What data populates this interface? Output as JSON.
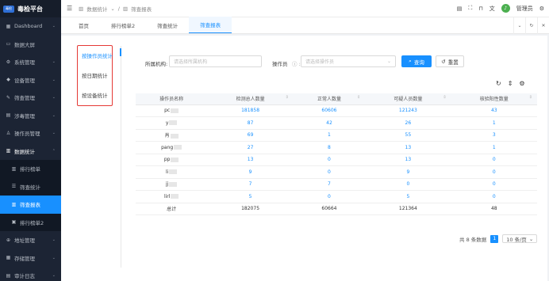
{
  "app": {
    "logo_mark": "毒检",
    "title": "毒检平台"
  },
  "sidebar": {
    "items": [
      {
        "icon": "dashboard-icon",
        "glyph": "▦",
        "label": "Dashboard",
        "chev": "⌄"
      },
      {
        "icon": "screen-icon",
        "glyph": "▭",
        "label": "数据大屏",
        "chev": ""
      },
      {
        "icon": "gear-icon",
        "glyph": "⚙",
        "label": "系统管理",
        "chev": "⌄"
      },
      {
        "icon": "device-icon",
        "glyph": "◆",
        "label": "设备管理",
        "chev": "⌄"
      },
      {
        "icon": "screening-icon",
        "glyph": "✎",
        "label": "筛查管理",
        "chev": "⌄"
      },
      {
        "icon": "drug-icon",
        "glyph": "▤",
        "label": "涉毒管理",
        "chev": "⌄"
      },
      {
        "icon": "operator-icon",
        "glyph": "♙",
        "label": "操作员管理",
        "chev": "⌄"
      },
      {
        "icon": "stats-icon",
        "glyph": "▥",
        "label": "数据统计",
        "chev": "⌃"
      },
      {
        "icon": "ranking-icon",
        "glyph": "▥",
        "label": "排行榜单",
        "chev": ""
      },
      {
        "icon": "filter-stats-icon",
        "glyph": "☰",
        "label": "筛查统计",
        "chev": ""
      },
      {
        "icon": "trend-icon",
        "glyph": "▥",
        "label": "筛查报表",
        "chev": ""
      },
      {
        "icon": "ranking2-icon",
        "glyph": "▣",
        "label": "排行榜单2",
        "chev": ""
      },
      {
        "icon": "location-icon",
        "glyph": "⊕",
        "label": "地址管理",
        "chev": "⌄"
      },
      {
        "icon": "storage-icon",
        "glyph": "▦",
        "label": "存储管理",
        "chev": "⌄"
      },
      {
        "icon": "audit-icon",
        "glyph": "▤",
        "label": "审计日志",
        "chev": "⌄"
      }
    ]
  },
  "topbar": {
    "breadcrumb": [
      "数据统计",
      "筛查报表"
    ],
    "user": "管理员",
    "avatar_text": "♪"
  },
  "tabs": [
    "首页",
    "排行榜单2",
    "筛查统计",
    "筛查报表"
  ],
  "left_nav": [
    "按操作员统计",
    "按日期统计",
    "按设备统计"
  ],
  "filters": {
    "org_label": "所属机构:",
    "org_placeholder": "请选择所属机构",
    "operator_label": "操作员",
    "operator_placeholder": "请选择操作员",
    "search_label": "查询",
    "reset_label": "重置"
  },
  "table": {
    "headers": [
      "操作员名称",
      "检测总人数量",
      "正常人数量",
      "可疑人员数量",
      "核验阳性数量"
    ],
    "rows": [
      {
        "name": "pc",
        "total": "181858",
        "normal": "60606",
        "suspect": "121243",
        "positive": "43"
      },
      {
        "name": "y",
        "total": "87",
        "normal": "42",
        "suspect": "26",
        "positive": "1"
      },
      {
        "name": "肖",
        "total": "69",
        "normal": "1",
        "suspect": "55",
        "positive": "3"
      },
      {
        "name": "pang",
        "total": "27",
        "normal": "8",
        "suspect": "13",
        "positive": "1"
      },
      {
        "name": "pp",
        "total": "13",
        "normal": "0",
        "suspect": "13",
        "positive": "0"
      },
      {
        "name": "li",
        "total": "9",
        "normal": "0",
        "suspect": "9",
        "positive": "0"
      },
      {
        "name": "jj",
        "total": "7",
        "normal": "7",
        "suspect": "0",
        "positive": "0"
      },
      {
        "name": "lirl",
        "total": "5",
        "normal": "0",
        "suspect": "5",
        "positive": "0"
      },
      {
        "name": "总计",
        "total": "182075",
        "normal": "60664",
        "suspect": "121364",
        "positive": "48"
      }
    ]
  },
  "pagination": {
    "total_text": "共 8 条数据",
    "page": "1",
    "page_size": "10 条/页"
  },
  "colors": {
    "accent": "#1890ff",
    "sidebar_bg": "#1c2434",
    "highlight_border": "#e53935"
  }
}
